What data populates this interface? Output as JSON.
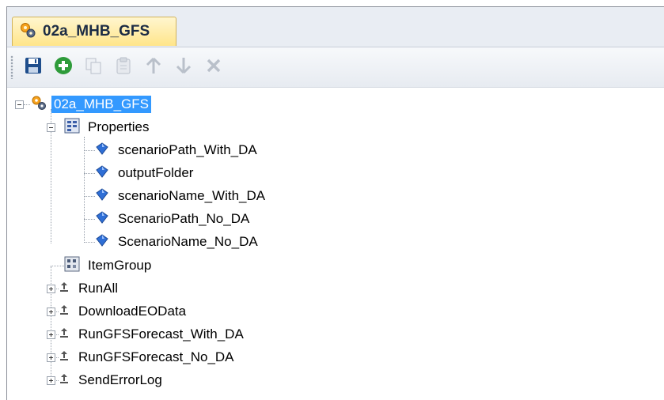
{
  "tab": {
    "label": "02a_MHB_GFS",
    "icon": "gears-icon"
  },
  "toolbar": {
    "buttons": [
      {
        "name": "save-button",
        "icon": "save-icon",
        "enabled": true
      },
      {
        "name": "add-button",
        "icon": "add-icon",
        "enabled": true
      },
      {
        "name": "copy-button",
        "icon": "copy-icon",
        "enabled": false
      },
      {
        "name": "paste-button",
        "icon": "paste-icon",
        "enabled": false
      },
      {
        "name": "move-up-button",
        "icon": "arrow-up-icon",
        "enabled": false
      },
      {
        "name": "move-down-button",
        "icon": "arrow-down-icon",
        "enabled": false
      },
      {
        "name": "delete-button",
        "icon": "delete-icon",
        "enabled": false
      }
    ]
  },
  "tree": {
    "root": {
      "label": "02a_MHB_GFS",
      "expanded": true,
      "selected": true
    },
    "properties": {
      "label": "Properties",
      "expanded": true,
      "items": [
        "scenarioPath_With_DA",
        "outputFolder",
        "scenarioName_With_DA",
        "ScenarioPath_No_DA",
        "ScenarioName_No_DA"
      ]
    },
    "item_group": {
      "label": "ItemGroup"
    },
    "targets": [
      "RunAll",
      "DownloadEOData",
      "RunGFSForecast_With_DA",
      "RunGFSForecast_No_DA",
      "SendErrorLog"
    ]
  },
  "colors": {
    "selection": "#3399ff",
    "tab_active": "#ffe58a",
    "add_green": "#2e9b3a",
    "save_blue": "#1f4e8c"
  }
}
